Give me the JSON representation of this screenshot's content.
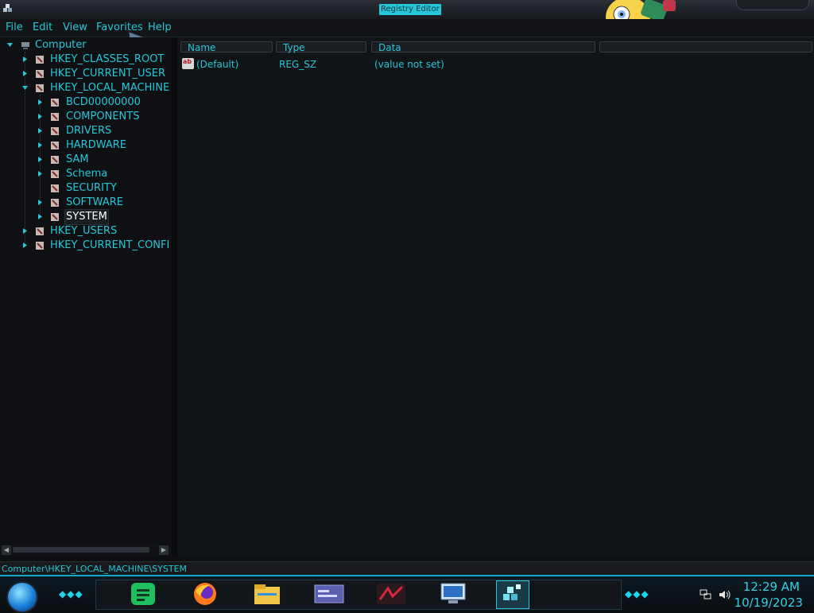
{
  "window": {
    "title": "Registry Editor"
  },
  "menu": {
    "file": "File",
    "edit": "Edit",
    "view": "View",
    "favorites": "Favorites",
    "help": "Help"
  },
  "tree": {
    "root": "Computer",
    "hives": [
      "HKEY_CLASSES_ROOT",
      "HKEY_CURRENT_USER",
      "HKEY_LOCAL_MACHINE",
      "HKEY_USERS",
      "HKEY_CURRENT_CONFI"
    ],
    "local_machine_children": [
      "BCD00000000",
      "COMPONENTS",
      "DRIVERS",
      "HARDWARE",
      "SAM",
      "Schema",
      "SECURITY",
      "SOFTWARE",
      "SYSTEM"
    ],
    "selected": "SYSTEM"
  },
  "list": {
    "headers": {
      "name": "Name",
      "type": "Type",
      "data": "Data"
    },
    "rows": [
      {
        "name": "(Default)",
        "type": "REG_SZ",
        "data": "(value not set)",
        "icon": "string-value-icon"
      }
    ]
  },
  "status": {
    "path": "Computer\\HKEY_LOCAL_MACHINE\\SYSTEM"
  },
  "taskbar": {
    "apps": [
      "notes-app-icon",
      "firefox-icon",
      "file-explorer-icon",
      "window-app-icon",
      "media-app-icon",
      "remote-desktop-icon",
      "registry-editor-icon"
    ],
    "time": "12:29 AM",
    "date": "10/19/2023"
  },
  "colors": {
    "accent": "#25c7d8",
    "background": "#0d0f12",
    "selected_text": "#ffffff"
  }
}
